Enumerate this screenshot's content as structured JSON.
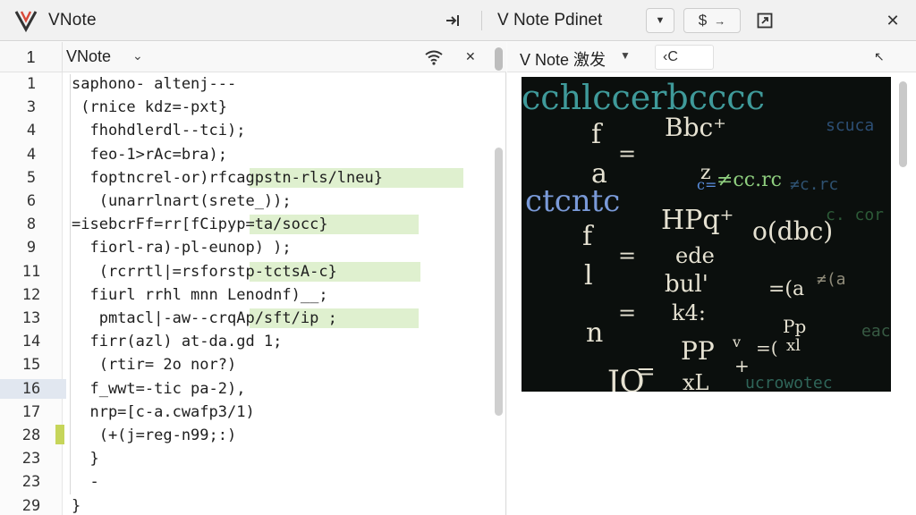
{
  "titlebar": {
    "app_title": "VNote",
    "preview_title": "V Note Pdinet",
    "dropdown_glyph": "▼",
    "sync_icon_text": "$",
    "sync_arrow": "→",
    "close_glyph": "✕"
  },
  "editor": {
    "header_line_number": "1",
    "tab_label": "VNote",
    "tab_chevron": "⌄",
    "pin_glyph": "✕",
    "line_numbers": [
      "1",
      "3",
      "4",
      "4",
      "5",
      "6",
      "8",
      "9",
      "11",
      "12",
      "13",
      "14",
      "15",
      "16",
      "17",
      "28",
      "23",
      "23",
      "29"
    ],
    "code_lines": [
      "saphono- altenj---",
      " (rnice kdz=-pxt}",
      "  fhohdlerdl--tci);",
      "  feo-1>rAc=bra);",
      "  foptncrel-or)rfcagpstn-rls/lneu}",
      "   (unarrlnart(srete_));",
      "=isebcrFf=rr[fCipyp=ta/socc}",
      "  fiorl-ra)-pl-eunop) );",
      "   (rcrrtl|=rsforstp-tctsA-c}",
      "  fiurl rrhl mnn Lenodnf)__;",
      "   pmtacl|-aw--crqAp/sft/ip ;",
      "  firr(azl) at-da.gd 1;",
      "   (rtir= 2o nor?)",
      "  f_wwt=-tic pa-2),",
      "  nrp=[c-a.cwafp3/1)",
      "   (+(j=reg-n99;:)",
      "  }",
      "  -",
      "}"
    ]
  },
  "preview": {
    "tab_label": "V Note 激发",
    "tab_chevron": "▼",
    "input_value": "‹C",
    "corner_glyph": "↖",
    "image_alt": "chalkboard-math-image",
    "image_formulas": [
      "f",
      "a",
      "=",
      "Bbc⁺",
      "z",
      "ctcntc",
      "c=",
      "≠cc.rc",
      "f",
      "l",
      "=",
      "HPq⁺",
      "ede",
      "o(dbc)",
      "bul'",
      "n",
      "=",
      "k4:",
      "=(a",
      "JO",
      "=",
      "PP",
      "v",
      "xL",
      "+",
      "=(",
      "Pp",
      "xl",
      "cchlccerbcccc"
    ]
  },
  "colors": {
    "title_bg": "#f1f1f1",
    "highlight": "#dff0cf",
    "marker": "#c6d55a",
    "current_line": "#e1e7f0",
    "chalkboard": "#0b0f0d"
  }
}
